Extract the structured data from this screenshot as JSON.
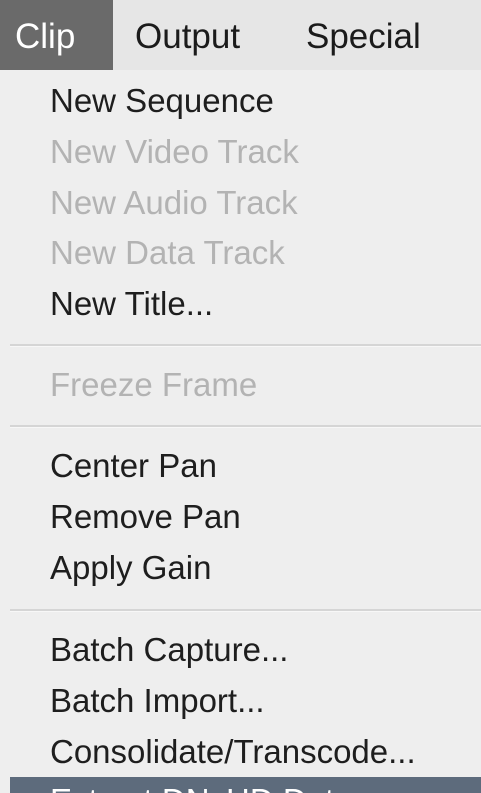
{
  "menubar": {
    "items": [
      "Clip",
      "Output",
      "Special"
    ]
  },
  "menu": {
    "items": [
      {
        "label": "New Sequence",
        "enabled": true
      },
      {
        "label": "New Video Track",
        "enabled": false
      },
      {
        "label": "New Audio Track",
        "enabled": false
      },
      {
        "label": "New Data Track",
        "enabled": false
      },
      {
        "label": "New Title...",
        "enabled": true
      },
      {
        "label": "Freeze Frame",
        "enabled": false
      },
      {
        "label": "Center Pan",
        "enabled": true
      },
      {
        "label": "Remove Pan",
        "enabled": true
      },
      {
        "label": "Apply Gain",
        "enabled": true
      },
      {
        "label": "Batch Capture...",
        "enabled": true
      },
      {
        "label": "Batch Import...",
        "enabled": true
      },
      {
        "label": "Consolidate/Transcode...",
        "enabled": true
      },
      {
        "label": "Extract DNxHD Data...",
        "enabled": true,
        "highlighted": true
      }
    ]
  },
  "colors": {
    "active_menu_bg": "#6a6a6a",
    "highlight_bg": "#5d6b7c",
    "disabled_text": "#b3b3b3"
  }
}
